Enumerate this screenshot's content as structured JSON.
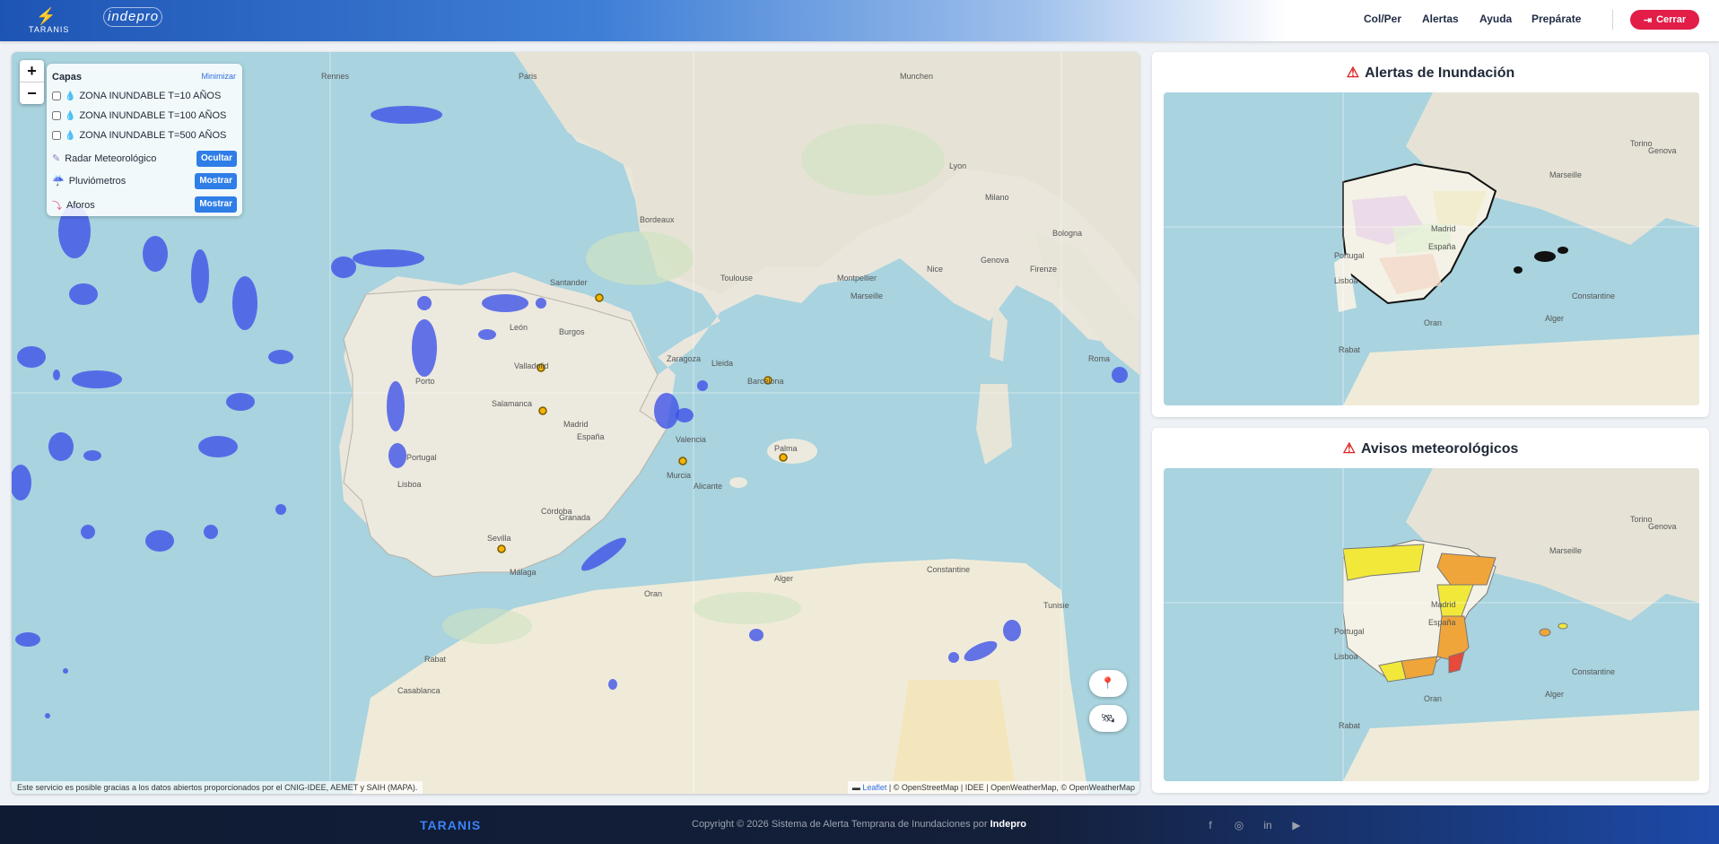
{
  "header": {
    "logos": [
      {
        "name": "taranis",
        "text": "TARANIS"
      },
      {
        "name": "indepro",
        "text": "indepro"
      }
    ],
    "nav": [
      {
        "label": "Col/Per"
      },
      {
        "label": "Alertas"
      },
      {
        "label": "Ayuda"
      },
      {
        "label": "Prepárate"
      }
    ],
    "close_label": "Cerrar"
  },
  "map": {
    "zoom_in": "+",
    "zoom_out": "−",
    "layers": {
      "title": "Capas",
      "minimize": "Minimizar",
      "zones": [
        {
          "label": "ZONA INUNDABLE T=10 AÑOS",
          "checked": false
        },
        {
          "label": "ZONA INUNDABLE T=100 AÑOS",
          "checked": false
        },
        {
          "label": "ZONA INUNDABLE T=500 AÑOS",
          "checked": false
        }
      ],
      "tools": [
        {
          "label": "Radar Meteorológico",
          "button": "Ocultar",
          "icon": "radar-icon"
        },
        {
          "label": "Pluviómetros",
          "button": "Mostrar",
          "icon": "rain-gauge-icon"
        },
        {
          "label": "Aforos",
          "button": "Mostrar",
          "icon": "gauge-chart-icon"
        }
      ]
    },
    "place_labels": [
      "Rennes",
      "Paris",
      "Munchen",
      "Bordeaux",
      "Toulouse",
      "Marseille",
      "Bologna",
      "Firenze",
      "Roma",
      "Zaragoza",
      "Barcelona",
      "Valladolid",
      "Salamanca",
      "Madrid",
      "España",
      "Lisboa",
      "Portugal",
      "Sevilla",
      "Málaga",
      "Palma",
      "Alger",
      "Oran",
      "Constantine",
      "Tunisie",
      "Casablanca",
      "Rabat",
      "Valencia",
      "Granada",
      "Murcia",
      "Alicante",
      "Córdoba",
      "Porto",
      "Santander",
      "León",
      "Burgos",
      "Lleida",
      "Genova",
      "Nice",
      "Montpellier",
      "Lyon",
      "Milano"
    ],
    "attribution_left": "Este servicio es posible gracias a los datos abiertos proporcionados por el CNIG-IDEE, AEMET y SAIH (MAPA).",
    "attribution_leaflet": "Leaflet",
    "attribution_rest": "| © OpenStreetMap | IDEE | OpenWeatherMap, © OpenWeatherMap"
  },
  "cards": {
    "flood_title": "Alertas de Inundación",
    "weather_title": "Avisos meteorológicos",
    "mini_labels": [
      "Lisboa",
      "Madrid",
      "Portugal",
      "España",
      "Oran",
      "Alger",
      "Constantine",
      "Rabat",
      "Marseille",
      "Torino",
      "Genova"
    ]
  },
  "footer": {
    "brand": "TARANIS",
    "copyright_prefix": "Copyright © 2026 Sistema de Alerta Temprana de Inundaciones por",
    "copyright_brand": "Indepro"
  },
  "colors": {
    "primary": "#2f7ee8",
    "danger": "#e11d48",
    "radar": "#3b4fe8",
    "sea": "#a8d3df",
    "land": "#eae6dc",
    "alert_yellow": "#f1e83a",
    "alert_orange": "#f0a53a",
    "alert_red": "#e74a3b"
  }
}
